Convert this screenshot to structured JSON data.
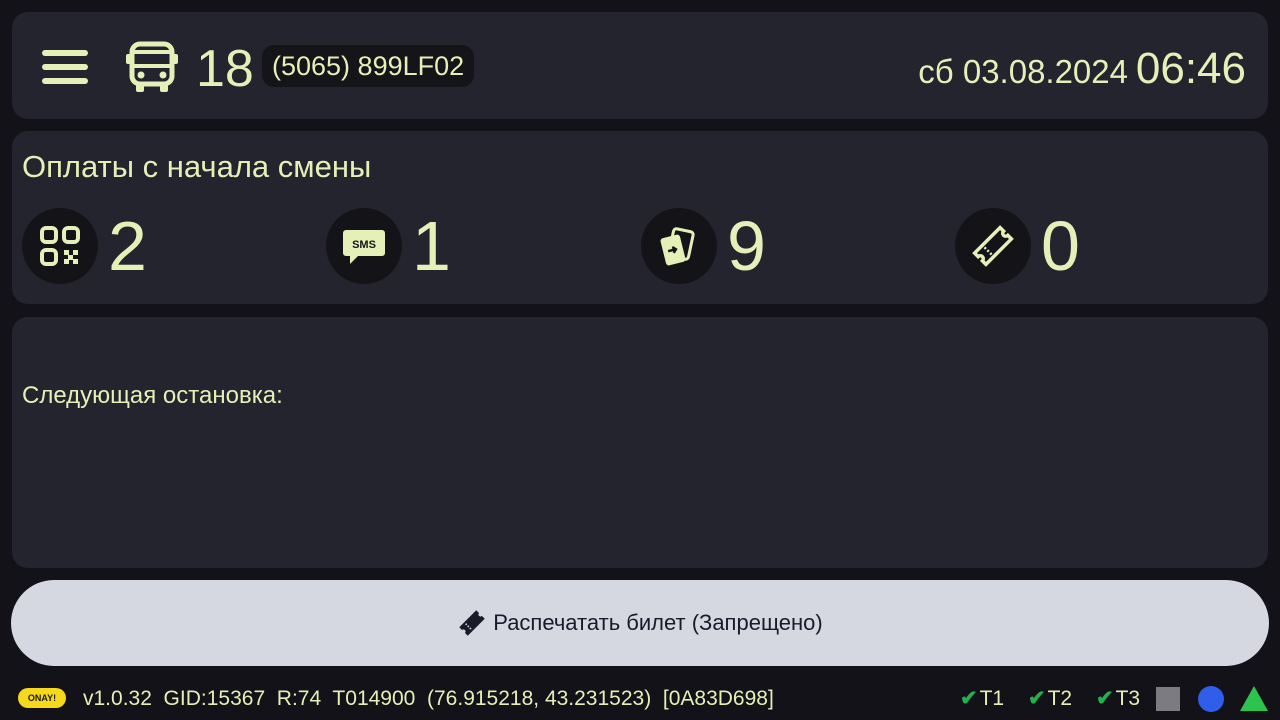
{
  "header": {
    "route_number": "18",
    "vehicle_id": "(5065) 899LF02",
    "date": "сб 03.08.2024",
    "time": "06:46",
    "icons": [
      "menu-icon",
      "bus-icon"
    ]
  },
  "payments": {
    "title": "Оплаты с начала смены",
    "items": [
      {
        "icon": "qr-code-icon",
        "count": "2"
      },
      {
        "icon": "sms-icon",
        "count": "1"
      },
      {
        "icon": "card-tap-icon",
        "count": "9"
      },
      {
        "icon": "ticket-icon",
        "count": "0"
      }
    ]
  },
  "next_stop": {
    "label": "Следующая остановка:"
  },
  "print_button": {
    "label": "Распечатать билет (Запрещено)",
    "icon": "ticket-icon"
  },
  "status_bar": {
    "logo_text": "ONAY!",
    "info": "v1.0.32  GID:15367  R:74  T014900  (76.915218, 43.231523)  [0A83D698]",
    "indicators": [
      "T1",
      "T2",
      "T3"
    ],
    "colors": {
      "check": "#22b14c",
      "square": "#7b7b80",
      "circle": "#2f5eea",
      "triangle": "#2dc44d"
    }
  },
  "colors": {
    "background": "#121218",
    "panel": "#24242e",
    "accent_text": "#e4f0b7",
    "button_bg": "#d5d7e1"
  }
}
